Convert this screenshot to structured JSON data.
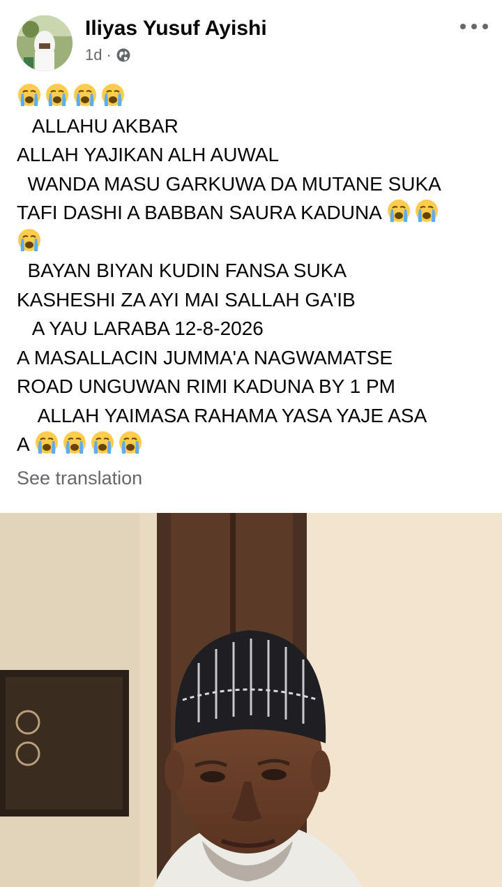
{
  "post": {
    "author": "Iliyas Yusuf Ayishi",
    "time": "1d",
    "separator": "·",
    "lines": [
      "",
      "   ALLAHU AKBAR",
      "ALLAH YAJIKAN ALH AUWAL",
      "  WANDA MASU GARKUWA DA MUTANE SUKA",
      "TAFI DASHI A BABBAN SAURA KADUNA ",
      "",
      "  BAYAN BIYAN KUDIN FANSA SUKA",
      "KASHESHI ZA AYI MAI SALLAH GA'IB",
      "   A YAU LARABA 12-8-2026",
      "A MASALLACIN JUMMA'A NAGWAMATSE",
      "ROAD UNGUWAN RIMI KADUNA BY 1 PM",
      "    ALLAH YAIMASA RAHAMA YASA YAJE ASA",
      "A "
    ],
    "line_emoji_counts": [
      4,
      0,
      0,
      0,
      2,
      1,
      0,
      0,
      0,
      0,
      0,
      0,
      4
    ],
    "emoji_icon": "loudly-crying-face-icon",
    "see_translation": "See translation"
  },
  "icons": {
    "privacy": "globe-icon",
    "more": "more-options-icon"
  },
  "colors": {
    "text": "#050505",
    "secondary": "#65676b",
    "background": "#ffffff"
  }
}
